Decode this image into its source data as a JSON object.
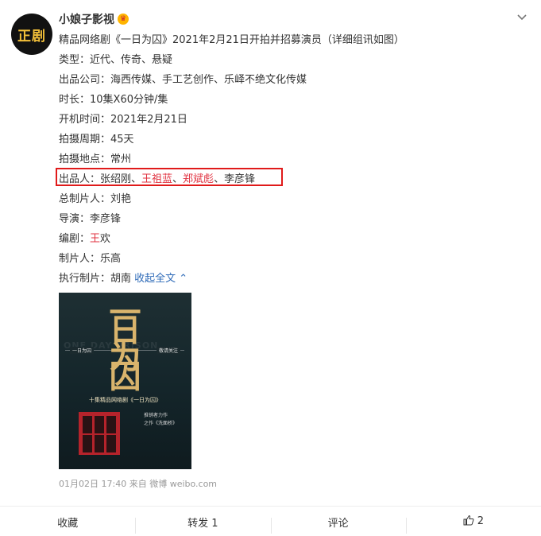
{
  "account": {
    "avatar_text": "正剧",
    "name": "小娘子影视",
    "badge": "♛"
  },
  "post": {
    "lines": [
      "精品网络剧《一日为囚》2021年2月21日开拍并招募演员（详细组讯如图）",
      "类型：近代、传奇、悬疑",
      "出品公司：海西传媒、手工艺创作、乐峄不绝文化传媒",
      "时长：10集X60分钟/集",
      "开机时间：2021年2月21日",
      "拍摄周期：45天",
      "拍摄地点：常州"
    ],
    "producers": {
      "label": "出品人：张绍刚、",
      "name_a": "王祖蓝",
      "sep_a": "、",
      "name_b": "郑斌彪",
      "sep_b": "、李彦锋"
    },
    "chief_producer": "总制片人：刘艳",
    "director": "导演：李彦锋",
    "writer": {
      "label": "编剧：",
      "highlight": "王",
      "rest": "欢"
    },
    "producer": "制片人：乐高",
    "exec_producer": {
      "label": "执行制片：胡南 ",
      "collapse": "收起全文"
    }
  },
  "poster": {
    "ghost_text": "ONE DAY PRISON",
    "chars": [
      "一",
      "日",
      "为",
      "囚"
    ],
    "left_tag": "一日为囚",
    "right_tag": "敬请关注",
    "subtitle": "十集精品网络剧《一日为囚》",
    "copy": "推销者力作",
    "footer": "之作《洗面桥》"
  },
  "meta": {
    "time": "01月02日 17:40",
    "source": "来自 微博 weibo.com"
  },
  "actions": {
    "favorite": "收藏",
    "repost": "转发 1",
    "comment": "评论",
    "like": "2"
  }
}
